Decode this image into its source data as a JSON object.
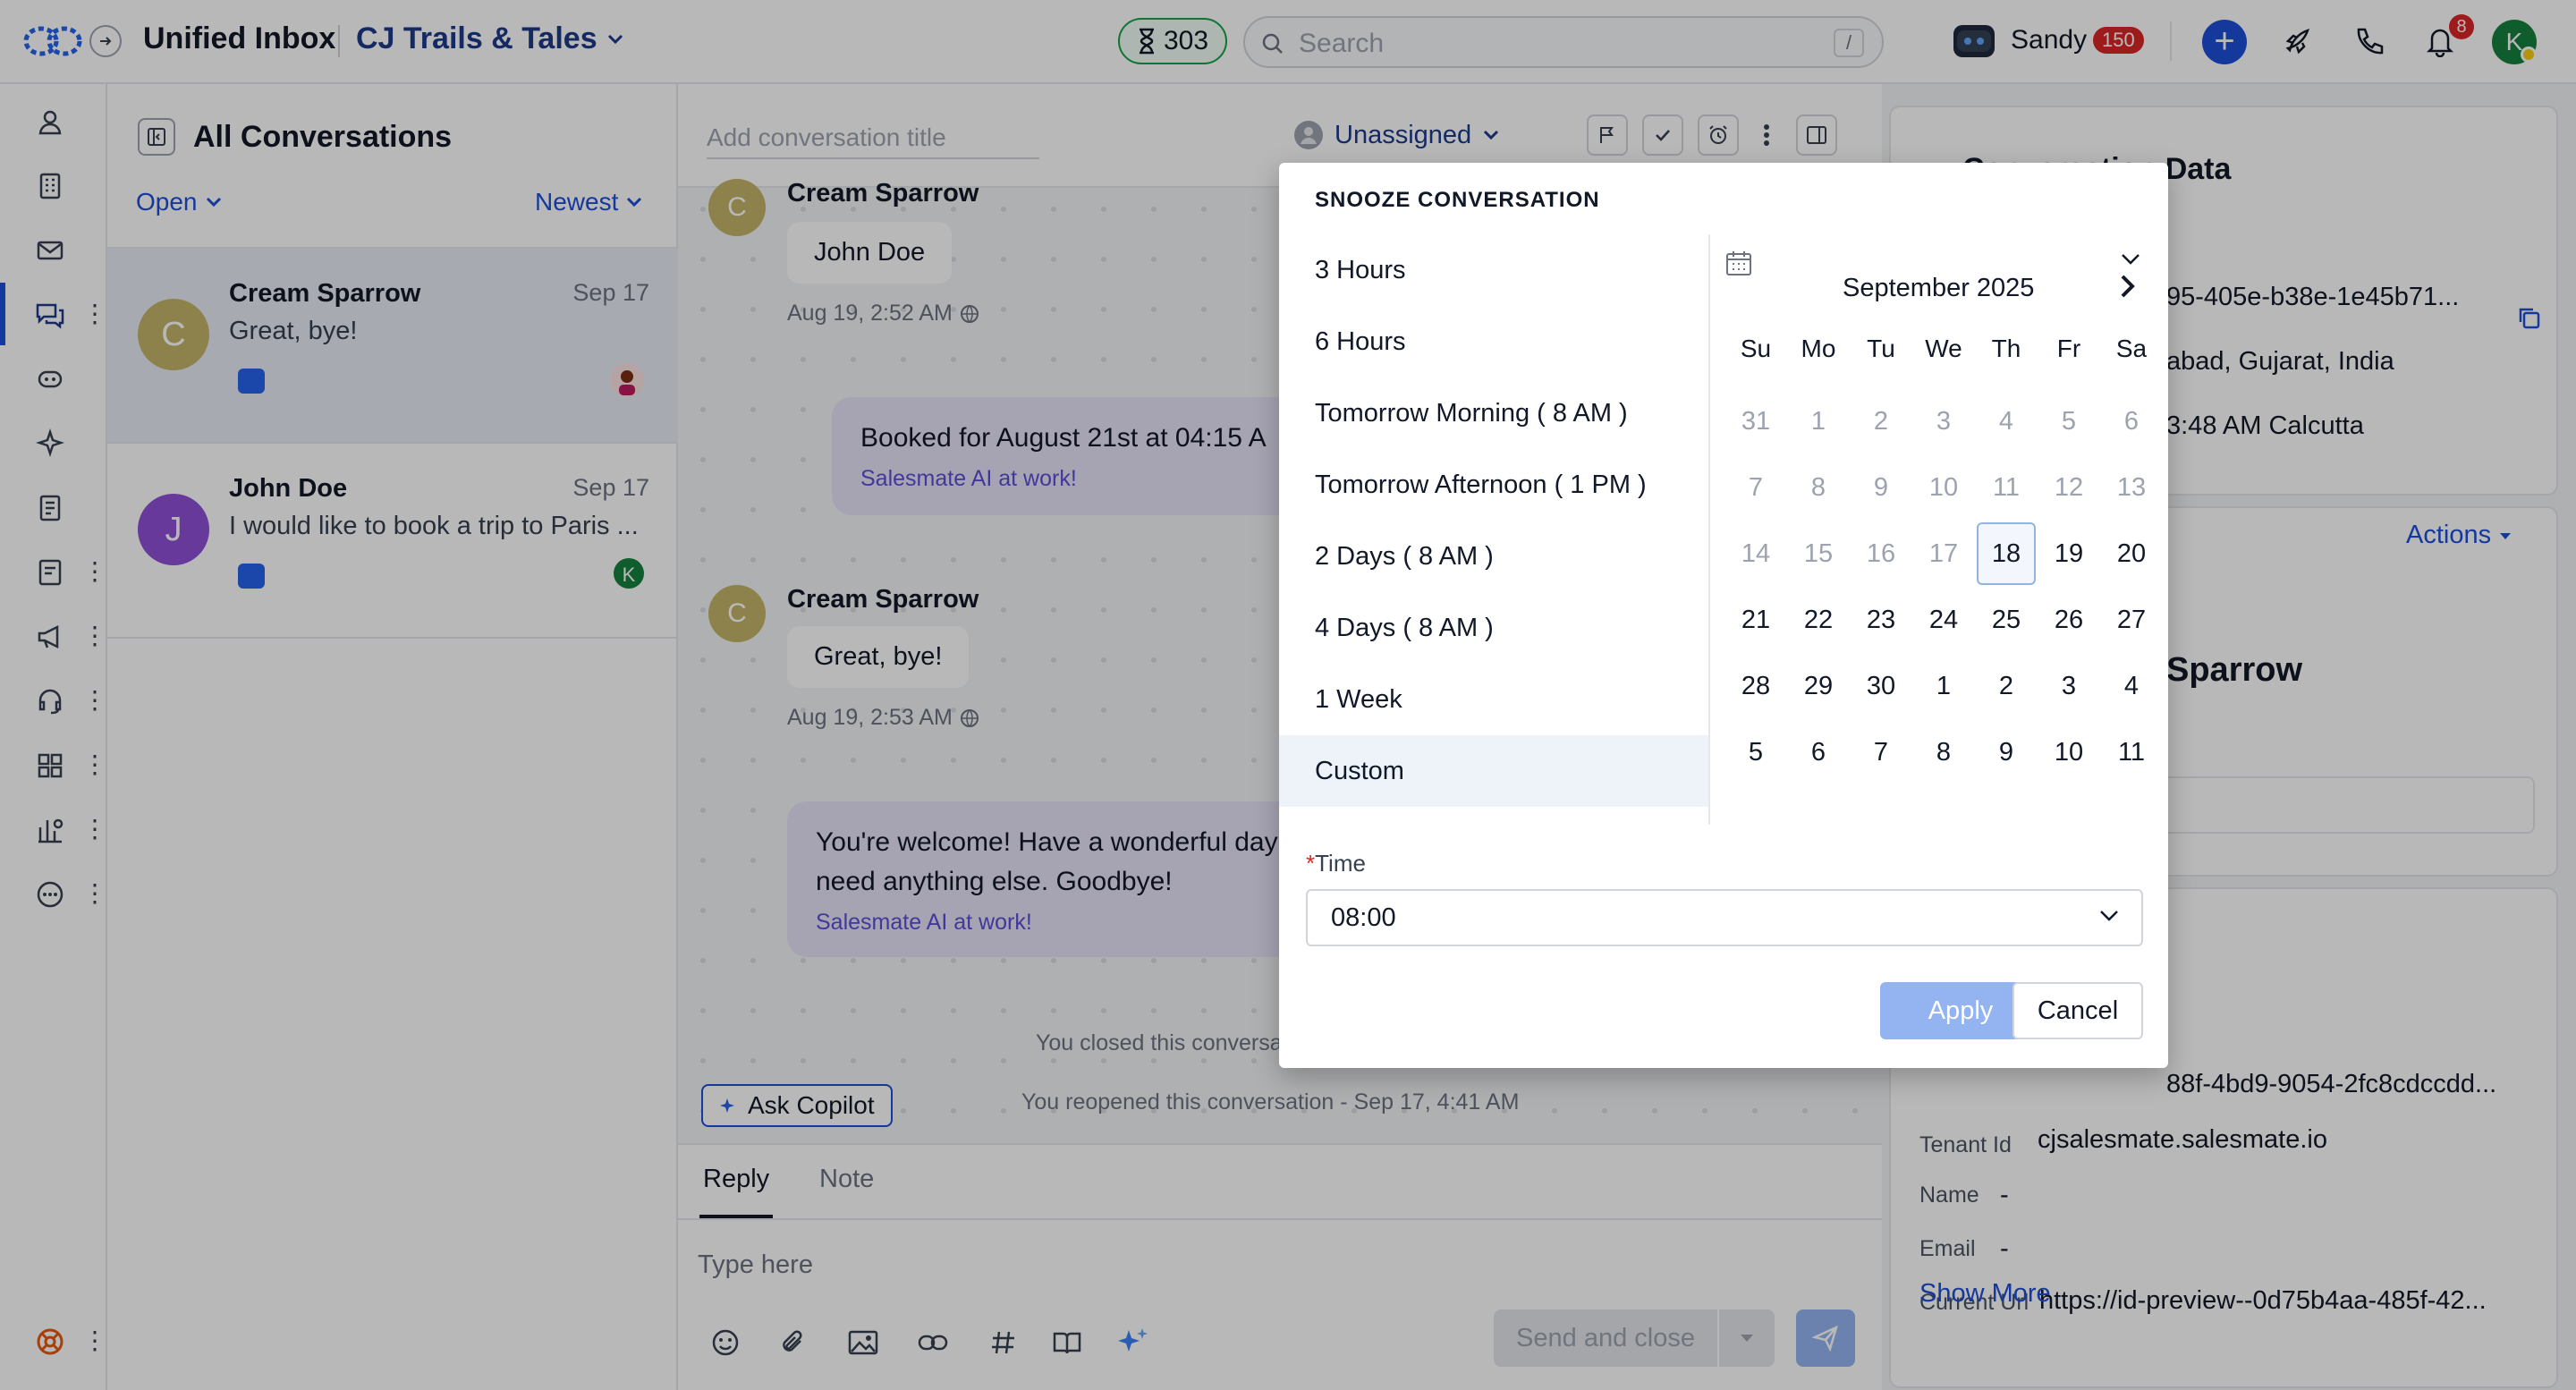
{
  "topbar": {
    "app_title": "Unified Inbox",
    "workspace": "CJ Trails & Tales",
    "timer_count": "303",
    "search_placeholder": "Search",
    "search_shortcut": "/",
    "agent_name": "Sandy",
    "agent_count": "150",
    "notification_count": "8",
    "user_initial": "K"
  },
  "list": {
    "title": "All Conversations",
    "status_filter": "Open",
    "sort": "Newest",
    "conversations": [
      {
        "initial": "C",
        "name": "Cream Sparrow",
        "date": "Sep 17",
        "preview": "Great, bye!",
        "avatar_color": "#c4b56a"
      },
      {
        "initial": "J",
        "name": "John Doe",
        "date": "Sep 17",
        "preview": "I would like to book a trip to Paris ...",
        "avatar_color": "#8e4fd6",
        "assignee_initial": "K"
      }
    ]
  },
  "chat": {
    "title_placeholder": "Add conversation title",
    "assignee": "Unassigned",
    "messages": {
      "m1_name": "Cream Sparrow",
      "m1_text": "John Doe",
      "m1_time": "Aug 19, 2:52 AM",
      "bot1_text": "Booked for August 21st at 04:15 A",
      "bot_tag": "Salesmate AI at work!",
      "m2_initial": "C",
      "m2_name": "Cream Sparrow",
      "m2_text": "Great, bye!",
      "m2_time": "Aug 19, 2:53 AM",
      "bot2_line1": "You're welcome! Have a wonderful day",
      "bot2_line2": "need anything else. Goodbye!",
      "m1_initial": "C"
    },
    "system": {
      "closed": "You closed this conversa",
      "reopened": "You reopened this conversation - Sep 17, 4:41 AM"
    },
    "copilot_label": "Ask Copilot",
    "composer": {
      "tab_reply": "Reply",
      "tab_note": "Note",
      "placeholder": "Type here",
      "send_close": "Send and close"
    }
  },
  "right_panel": {
    "section_title": "Conversation Data",
    "id_value": "95-405e-b38e-1e45b71...",
    "location": "abad, Gujarat, India",
    "local_time": "3:48 AM Calcutta",
    "actions_label": "Actions",
    "contact_name": "Sparrow",
    "tenant_id_partial": "88f-4bd9-9054-2fc8cdccdd...",
    "tenant_key": "Tenant Id",
    "tenant_value": "cjsalesmate.salesmate.io",
    "name_key": "Name",
    "name_value": "-",
    "email_key": "Email",
    "email_value": "-",
    "url_key": "Current Url",
    "url_value": "https://id-preview--0d75b4aa-485f-42...",
    "show_more": "Show More"
  },
  "snooze": {
    "title": "SNOOZE CONVERSATION",
    "options": [
      "3 Hours",
      "6 Hours",
      "Tomorrow Morning ( 8 AM )",
      "Tomorrow Afternoon ( 1 PM )",
      "2 Days ( 8 AM )",
      "4 Days ( 8 AM )",
      "1 Week",
      "Custom"
    ],
    "selected_option": "Custom",
    "calendar": {
      "month_label": "September 2025",
      "weekdays": [
        "Su",
        "Mo",
        "Tu",
        "We",
        "Th",
        "Fr",
        "Sa"
      ],
      "weeks": [
        [
          "31",
          "1",
          "2",
          "3",
          "4",
          "5",
          "6"
        ],
        [
          "7",
          "8",
          "9",
          "10",
          "11",
          "12",
          "13"
        ],
        [
          "14",
          "15",
          "16",
          "17",
          "18",
          "19",
          "20"
        ],
        [
          "21",
          "22",
          "23",
          "24",
          "25",
          "26",
          "27"
        ],
        [
          "28",
          "29",
          "30",
          "1",
          "2",
          "3",
          "4"
        ],
        [
          "5",
          "6",
          "7",
          "8",
          "9",
          "10",
          "11"
        ]
      ],
      "today": "18"
    },
    "time_label": "Time",
    "time_value": "08:00",
    "apply_label": "Apply",
    "cancel_label": "Cancel"
  },
  "colors": {
    "accent": "#1d4ed8",
    "bot_bubble": "#e6e3f7",
    "bot_tag": "#5b4fd6",
    "apply_disabled": "#93b4f0"
  }
}
